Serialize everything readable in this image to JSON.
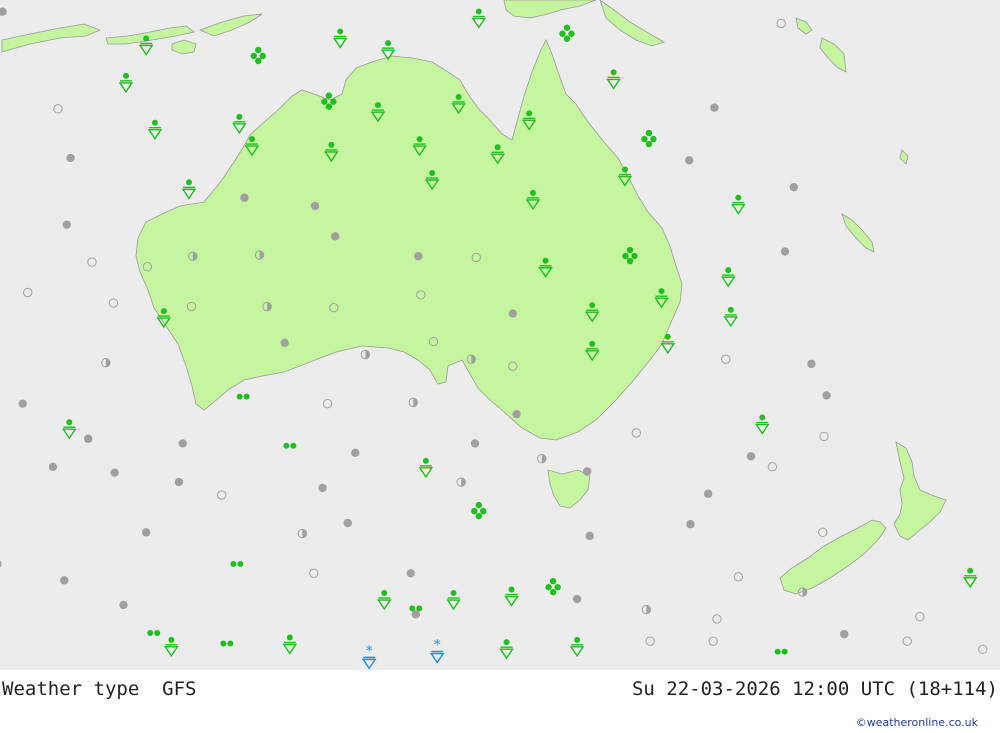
{
  "map": {
    "land_color": "#c6f5a0",
    "coast_color": "#9a9a9a",
    "sea_color": "#ececec",
    "symbols": {
      "dry": "#a0a0a0",
      "rain": "#1fbf1f",
      "snow": "#1e8fe6",
      "thunder": "#1fbf1f"
    },
    "stations": [
      {
        "type": "dry",
        "fill": "solid",
        "lon": 110.2,
        "lat": -6.0
      },
      {
        "type": "shower",
        "lon": 121.6,
        "lat": -8.8
      },
      {
        "type": "shower",
        "lon": 120.0,
        "lat": -12.0
      },
      {
        "type": "showers-hail",
        "lon": 130.5,
        "lat": -9.7
      },
      {
        "type": "shower",
        "lon": 137.0,
        "lat": -8.2
      },
      {
        "type": "shower",
        "lon": 140.8,
        "lat": -9.2
      },
      {
        "type": "shower",
        "lon": 148.0,
        "lat": -6.5
      },
      {
        "type": "showers-hail",
        "lon": 155.0,
        "lat": -7.8
      },
      {
        "type": "shower",
        "lon": 158.7,
        "lat": -11.7
      },
      {
        "type": "dry",
        "fill": "open",
        "lon": 172.0,
        "lat": -7.0
      },
      {
        "type": "dry",
        "fill": "open",
        "lon": 114.6,
        "lat": -14.3
      },
      {
        "type": "shower",
        "lon": 122.3,
        "lat": -16.0
      },
      {
        "type": "shower",
        "lon": 129.0,
        "lat": -15.5
      },
      {
        "type": "showers-hail",
        "lon": 136.1,
        "lat": -13.6
      },
      {
        "type": "shower",
        "lon": 140.0,
        "lat": -14.5
      },
      {
        "type": "shower",
        "lon": 146.4,
        "lat": -13.8
      },
      {
        "type": "shower",
        "lon": 152.0,
        "lat": -15.2
      },
      {
        "type": "dry",
        "fill": "solid",
        "lon": 166.7,
        "lat": -14.2
      },
      {
        "type": "dry",
        "fill": "solid",
        "lon": 115.6,
        "lat": -18.5
      },
      {
        "type": "shower",
        "lon": 125.0,
        "lat": -21.1
      },
      {
        "type": "shower",
        "lon": 130.0,
        "lat": -17.4
      },
      {
        "type": "shower",
        "lon": 136.3,
        "lat": -17.9
      },
      {
        "type": "shower",
        "lon": 143.3,
        "lat": -17.4
      },
      {
        "type": "shower",
        "lon": 149.5,
        "lat": -18.1
      },
      {
        "type": "showers-hail",
        "lon": 161.5,
        "lat": -16.8
      },
      {
        "type": "dry",
        "fill": "solid",
        "lon": 164.7,
        "lat": -18.7
      },
      {
        "type": "dry",
        "fill": "solid",
        "lon": 173.0,
        "lat": -21.0
      },
      {
        "type": "dry",
        "fill": "solid",
        "lon": 115.3,
        "lat": -24.2
      },
      {
        "type": "dry",
        "fill": "solid",
        "lon": 129.4,
        "lat": -21.9
      },
      {
        "type": "dry",
        "fill": "solid",
        "lon": 135.0,
        "lat": -22.6
      },
      {
        "type": "shower",
        "lon": 144.3,
        "lat": -20.3
      },
      {
        "type": "shower",
        "lon": 152.3,
        "lat": -22.0
      },
      {
        "type": "shower",
        "lon": 159.6,
        "lat": -20.0
      },
      {
        "type": "shower",
        "lon": 168.6,
        "lat": -22.4
      },
      {
        "type": "dry",
        "fill": "solid",
        "lon": 172.3,
        "lat": -26.5
      },
      {
        "type": "dry",
        "fill": "open",
        "lon": 117.3,
        "lat": -27.4
      },
      {
        "type": "dry",
        "fill": "open",
        "lon": 121.7,
        "lat": -27.8
      },
      {
        "type": "dry",
        "fill": "half",
        "lon": 125.3,
        "lat": -26.9
      },
      {
        "type": "dry",
        "fill": "half",
        "lon": 130.6,
        "lat": -26.8
      },
      {
        "type": "dry",
        "fill": "solid",
        "lon": 136.6,
        "lat": -25.2
      },
      {
        "type": "dry",
        "fill": "solid",
        "lon": 143.2,
        "lat": -26.9
      },
      {
        "type": "dry",
        "fill": "open",
        "lon": 147.8,
        "lat": -27.0
      },
      {
        "type": "shower",
        "lon": 153.3,
        "lat": -27.8
      },
      {
        "type": "showers-hail",
        "lon": 160.0,
        "lat": -26.8
      },
      {
        "type": "shower",
        "lon": 167.8,
        "lat": -28.6
      },
      {
        "type": "dry",
        "fill": "open",
        "lon": 112.2,
        "lat": -30.0
      },
      {
        "type": "dry",
        "fill": "open",
        "lon": 119.0,
        "lat": -30.9
      },
      {
        "type": "dry",
        "fill": "open",
        "lon": 125.2,
        "lat": -31.2
      },
      {
        "type": "dry",
        "fill": "half",
        "lon": 131.2,
        "lat": -31.2
      },
      {
        "type": "dry",
        "fill": "open",
        "lon": 136.5,
        "lat": -31.3
      },
      {
        "type": "dry",
        "fill": "open",
        "lon": 143.4,
        "lat": -30.2
      },
      {
        "type": "dry",
        "fill": "solid",
        "lon": 150.7,
        "lat": -31.8
      },
      {
        "type": "shower",
        "lon": 157.0,
        "lat": -31.6
      },
      {
        "type": "shower",
        "lon": 162.5,
        "lat": -30.4
      },
      {
        "type": "shower",
        "lon": 168.0,
        "lat": -32.0
      },
      {
        "type": "shower",
        "lon": 123.0,
        "lat": -32.1
      },
      {
        "type": "dry",
        "fill": "half",
        "lon": 118.4,
        "lat": -36.0
      },
      {
        "type": "dry",
        "fill": "solid",
        "lon": 132.6,
        "lat": -34.3
      },
      {
        "type": "dry",
        "fill": "half",
        "lon": 139.0,
        "lat": -35.3
      },
      {
        "type": "dry",
        "fill": "open",
        "lon": 144.4,
        "lat": -34.2
      },
      {
        "type": "dry",
        "fill": "half",
        "lon": 147.4,
        "lat": -35.7
      },
      {
        "type": "dry",
        "fill": "open",
        "lon": 150.7,
        "lat": -36.3
      },
      {
        "type": "shower",
        "lon": 157.0,
        "lat": -34.9
      },
      {
        "type": "shower",
        "lon": 163.0,
        "lat": -34.3
      },
      {
        "type": "dry",
        "fill": "open",
        "lon": 167.6,
        "lat": -35.7
      },
      {
        "type": "dry",
        "fill": "solid",
        "lon": 174.4,
        "lat": -36.1
      },
      {
        "type": "dry",
        "fill": "solid",
        "lon": 111.8,
        "lat": -39.5
      },
      {
        "type": "drizzle",
        "lon": 129.3,
        "lat": -38.9
      },
      {
        "type": "shower",
        "lon": 115.5,
        "lat": -41.6
      },
      {
        "type": "dry",
        "fill": "open",
        "lon": 136.0,
        "lat": -39.5
      },
      {
        "type": "dry",
        "fill": "half",
        "lon": 142.8,
        "lat": -39.4
      },
      {
        "type": "dry",
        "fill": "solid",
        "lon": 151.0,
        "lat": -40.4
      },
      {
        "type": "shower",
        "lon": 170.5,
        "lat": -41.2
      },
      {
        "type": "dry",
        "fill": "solid",
        "lon": 175.6,
        "lat": -38.8
      },
      {
        "type": "dry",
        "fill": "solid",
        "lon": 117.0,
        "lat": -42.5
      },
      {
        "type": "dry",
        "fill": "solid",
        "lon": 124.5,
        "lat": -42.9
      },
      {
        "type": "drizzle",
        "lon": 133.0,
        "lat": -43.1
      },
      {
        "type": "dry",
        "fill": "solid",
        "lon": 138.2,
        "lat": -43.7
      },
      {
        "type": "dry",
        "fill": "solid",
        "lon": 147.7,
        "lat": -42.9
      },
      {
        "type": "dry",
        "fill": "half",
        "lon": 153.0,
        "lat": -44.2
      },
      {
        "type": "dry",
        "fill": "open",
        "lon": 160.5,
        "lat": -42.0
      },
      {
        "type": "dry",
        "fill": "solid",
        "lon": 169.6,
        "lat": -44.0
      },
      {
        "type": "dry",
        "fill": "open",
        "lon": 175.4,
        "lat": -42.3
      },
      {
        "type": "dry",
        "fill": "solid",
        "lon": 114.2,
        "lat": -44.9
      },
      {
        "type": "dry",
        "fill": "solid",
        "lon": 119.1,
        "lat": -45.4
      },
      {
        "type": "dry",
        "fill": "solid",
        "lon": 124.2,
        "lat": -46.2
      },
      {
        "type": "dry",
        "fill": "open",
        "lon": 127.6,
        "lat": -47.3
      },
      {
        "type": "dry",
        "fill": "solid",
        "lon": 135.6,
        "lat": -46.7
      },
      {
        "type": "shower",
        "lon": 143.8,
        "lat": -44.9
      },
      {
        "type": "dry",
        "fill": "half",
        "lon": 146.6,
        "lat": -46.2
      },
      {
        "type": "dry",
        "fill": "solid",
        "lon": 156.6,
        "lat": -45.3
      },
      {
        "type": "dry",
        "fill": "solid",
        "lon": 166.2,
        "lat": -47.2
      },
      {
        "type": "dry",
        "fill": "open",
        "lon": 171.3,
        "lat": -44.9
      },
      {
        "type": "dry",
        "fill": "half",
        "lon": 109.0,
        "lat": -48.1
      },
      {
        "type": "dry",
        "fill": "solid",
        "lon": 121.6,
        "lat": -50.5
      },
      {
        "type": "dry",
        "fill": "half",
        "lon": 134.0,
        "lat": -50.6
      },
      {
        "type": "dry",
        "fill": "solid",
        "lon": 137.6,
        "lat": -49.7
      },
      {
        "type": "showers-hail",
        "lon": 148.0,
        "lat": -48.6
      },
      {
        "type": "dry",
        "fill": "solid",
        "lon": 156.8,
        "lat": -50.8
      },
      {
        "type": "dry",
        "fill": "solid",
        "lon": 164.8,
        "lat": -49.8
      },
      {
        "type": "dry",
        "fill": "open",
        "lon": 175.3,
        "lat": -50.5
      },
      {
        "type": "dry",
        "fill": "solid",
        "lon": 109.8,
        "lat": -53.2
      },
      {
        "type": "dry",
        "fill": "solid",
        "lon": 115.1,
        "lat": -54.6
      },
      {
        "type": "drizzle",
        "lon": 128.8,
        "lat": -53.2
      },
      {
        "type": "dry",
        "fill": "open",
        "lon": 134.9,
        "lat": -54.0
      },
      {
        "type": "dry",
        "fill": "solid",
        "lon": 142.6,
        "lat": -54.0
      },
      {
        "type": "drizzle",
        "lon": 143.0,
        "lat": -57.0
      },
      {
        "type": "showers-hail",
        "lon": 153.9,
        "lat": -55.1
      },
      {
        "type": "dry",
        "fill": "open",
        "lon": 168.6,
        "lat": -54.3
      },
      {
        "type": "dry",
        "fill": "half",
        "lon": 173.7,
        "lat": -55.6
      },
      {
        "type": "shower",
        "lon": 187.0,
        "lat": -54.3
      },
      {
        "type": "dry",
        "fill": "solid",
        "lon": 109.6,
        "lat": -56.9
      },
      {
        "type": "dry",
        "fill": "solid",
        "lon": 119.8,
        "lat": -56.7
      },
      {
        "type": "drizzle",
        "lon": 128.0,
        "lat": -60.0
      },
      {
        "type": "shower",
        "lon": 133.0,
        "lat": -60.0
      },
      {
        "type": "dry",
        "fill": "solid",
        "lon": 143.0,
        "lat": -57.5
      },
      {
        "type": "shower",
        "lon": 140.5,
        "lat": -56.2
      },
      {
        "type": "shower",
        "lon": 146.0,
        "lat": -56.2
      },
      {
        "type": "shower",
        "lon": 150.6,
        "lat": -55.9
      },
      {
        "type": "dry",
        "fill": "solid",
        "lon": 155.8,
        "lat": -56.2
      },
      {
        "type": "dry",
        "fill": "half",
        "lon": 161.3,
        "lat": -57.1
      },
      {
        "type": "dry",
        "fill": "open",
        "lon": 166.9,
        "lat": -57.9
      },
      {
        "type": "dry",
        "fill": "solid",
        "lon": 177.0,
        "lat": -59.2
      },
      {
        "type": "dry",
        "fill": "open",
        "lon": 183.0,
        "lat": -57.7
      },
      {
        "type": "drizzle",
        "lon": 122.2,
        "lat": -59.1
      },
      {
        "type": "shower",
        "lon": 123.6,
        "lat": -60.2
      },
      {
        "type": "snow",
        "lon": 139.3,
        "lat": -61.1
      },
      {
        "type": "snow",
        "lon": 144.7,
        "lat": -60.6
      },
      {
        "type": "shower",
        "lon": 150.2,
        "lat": -60.4
      },
      {
        "type": "shower",
        "lon": 155.8,
        "lat": -60.2
      },
      {
        "type": "dry",
        "fill": "open",
        "lon": 161.6,
        "lat": -59.8
      },
      {
        "type": "dry",
        "fill": "open",
        "lon": 166.6,
        "lat": -59.8
      },
      {
        "type": "drizzle",
        "lon": 172.0,
        "lat": -60.7
      },
      {
        "type": "dry",
        "fill": "open",
        "lon": 182.0,
        "lat": -59.8
      },
      {
        "type": "dry",
        "fill": "open",
        "lon": 188.0,
        "lat": -60.5
      }
    ]
  },
  "footer": {
    "title": "Weather type  GFS",
    "datetime": "Su 22-03-2026 12:00 UTC (18+114)",
    "credit": "©weatheronline.co.uk"
  }
}
